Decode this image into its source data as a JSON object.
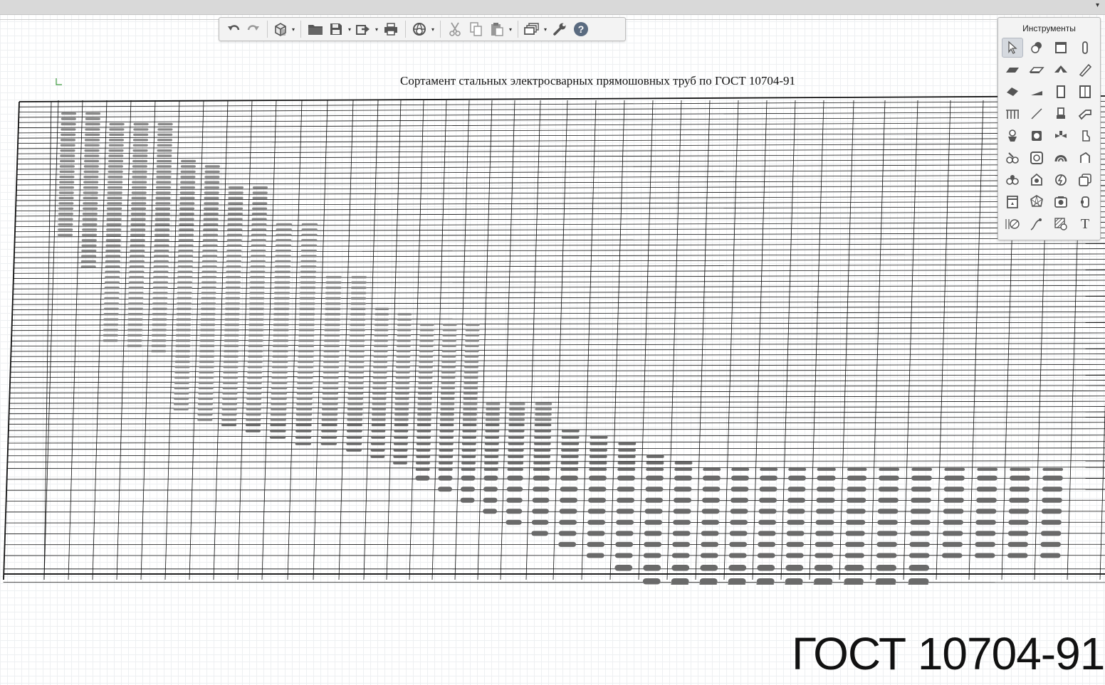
{
  "window": {
    "topbar_caret": "▾"
  },
  "toolbar": {
    "buttons": [
      {
        "name": "undo-button",
        "icon": "undo-icon"
      },
      {
        "name": "redo-button",
        "icon": "redo-icon"
      },
      {
        "name": "view-3d-button",
        "icon": "cube-icon",
        "dropdown": true
      },
      {
        "name": "open-button",
        "icon": "folder-icon"
      },
      {
        "name": "save-button",
        "icon": "floppy-icon",
        "dropdown": true
      },
      {
        "name": "export-button",
        "icon": "export-icon",
        "dropdown": true
      },
      {
        "name": "print-button",
        "icon": "printer-icon"
      },
      {
        "name": "sync-button",
        "icon": "globe-sync-icon",
        "dropdown": true
      },
      {
        "name": "cut-button",
        "icon": "scissors-icon"
      },
      {
        "name": "copy-button",
        "icon": "copy-icon"
      },
      {
        "name": "paste-button",
        "icon": "clipboard-icon",
        "dropdown": true
      },
      {
        "name": "layers-button",
        "icon": "layers-icon",
        "dropdown": true
      },
      {
        "name": "settings-button",
        "icon": "wrench-icon"
      },
      {
        "name": "help-button",
        "icon": "help-circle-icon",
        "label": "?"
      }
    ],
    "dropdown_glyph": "▾"
  },
  "palette": {
    "title": "Инструменты",
    "tools": [
      "select-arrow-icon",
      "stamp-shape-icon",
      "wall-rect-icon",
      "column-icon",
      "slab-icon",
      "plate-icon",
      "roof-icon",
      "beam-icon",
      "stair-icon",
      "ramp-icon",
      "door-icon",
      "window-icon",
      "railing-icon",
      "line-icon",
      "fixture-icon",
      "pipe-icon",
      "toilet-icon",
      "boiler-icon",
      "valve-icon",
      "faucet-icon",
      "radiator-icon",
      "fan-icon",
      "duct-icon",
      "duct-fitting-icon",
      "ac-unit-icon",
      "lamp-icon",
      "socket-icon",
      "panel-icon",
      "cabinet-icon",
      "polyhedron-icon",
      "camera-icon",
      "label-icon",
      "dimension-icon",
      "leader-icon",
      "hatch-icon",
      "text-tool-icon"
    ],
    "text_tool_label": "T"
  },
  "drawing": {
    "title": "Сортамент стальных электросварных прямошовных труб по ГОСТ 10704-91",
    "stamp": "ГОСТ 10704-91"
  },
  "colors": {
    "grid_line": "#111111",
    "pipe_fill": "#8a8a8a",
    "pipe_dark": "#6a6a6a",
    "icon_gray": "#555555",
    "help_fill": "#5a6b80"
  }
}
